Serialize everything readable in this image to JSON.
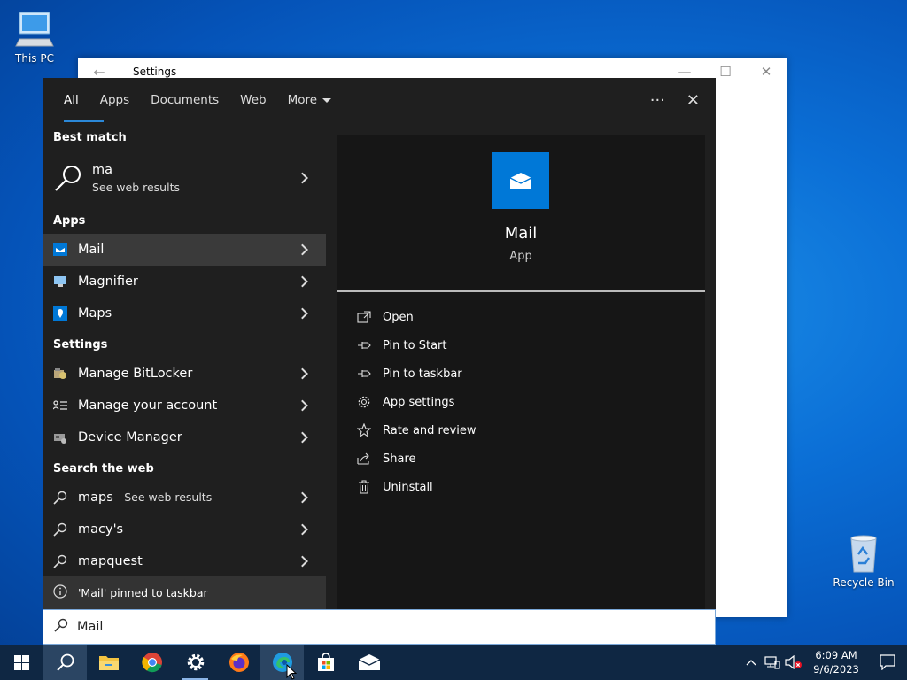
{
  "desktop": {
    "icons": [
      {
        "label": "This PC"
      },
      {
        "label": "Recycle Bin"
      }
    ]
  },
  "settings_window": {
    "title": "Settings",
    "back": "←",
    "minimize": "—",
    "maximize": "☐",
    "close": "✕"
  },
  "search": {
    "tabs": [
      {
        "label": "All",
        "active": true
      },
      {
        "label": "Apps"
      },
      {
        "label": "Documents"
      },
      {
        "label": "Web"
      },
      {
        "label": "More"
      }
    ],
    "more_options": "···",
    "close": "✕",
    "best_match": {
      "header": "Best match",
      "title": "ma",
      "subtitle": "See web results"
    },
    "apps": {
      "header": "Apps",
      "items": [
        {
          "label": "Mail"
        },
        {
          "label": "Magnifier"
        },
        {
          "label": "Maps"
        }
      ]
    },
    "settings": {
      "header": "Settings",
      "items": [
        {
          "label": "Manage BitLocker"
        },
        {
          "label": "Manage your account"
        },
        {
          "label": "Device Manager"
        }
      ]
    },
    "web": {
      "header": "Search the web",
      "items": [
        {
          "label": "maps",
          "suffix": " - See web results"
        },
        {
          "label": "macy's"
        },
        {
          "label": "mapquest"
        }
      ]
    },
    "toast": "'Mail' pinned to taskbar",
    "preview": {
      "title": "Mail",
      "subtitle": "App",
      "actions": [
        {
          "label": "Open",
          "icon": "open-icon"
        },
        {
          "label": "Pin to Start",
          "icon": "pin-icon"
        },
        {
          "label": "Pin to taskbar",
          "icon": "pin-icon"
        },
        {
          "label": "App settings",
          "icon": "gear-icon"
        },
        {
          "label": "Rate and review",
          "icon": "star-icon"
        },
        {
          "label": "Share",
          "icon": "share-icon"
        },
        {
          "label": "Uninstall",
          "icon": "trash-icon"
        }
      ]
    },
    "query": "Mail"
  },
  "taskbar": {
    "apps": [
      "start",
      "search",
      "file-explorer",
      "chrome",
      "settings",
      "firefox",
      "edge",
      "store",
      "mail"
    ],
    "clock": {
      "time": "6:09 AM",
      "date": "9/6/2023"
    }
  },
  "colors": {
    "accent": "#0078d7",
    "panel": "#1f1f1f",
    "preview": "#161616",
    "taskbar": "#0f2743"
  }
}
